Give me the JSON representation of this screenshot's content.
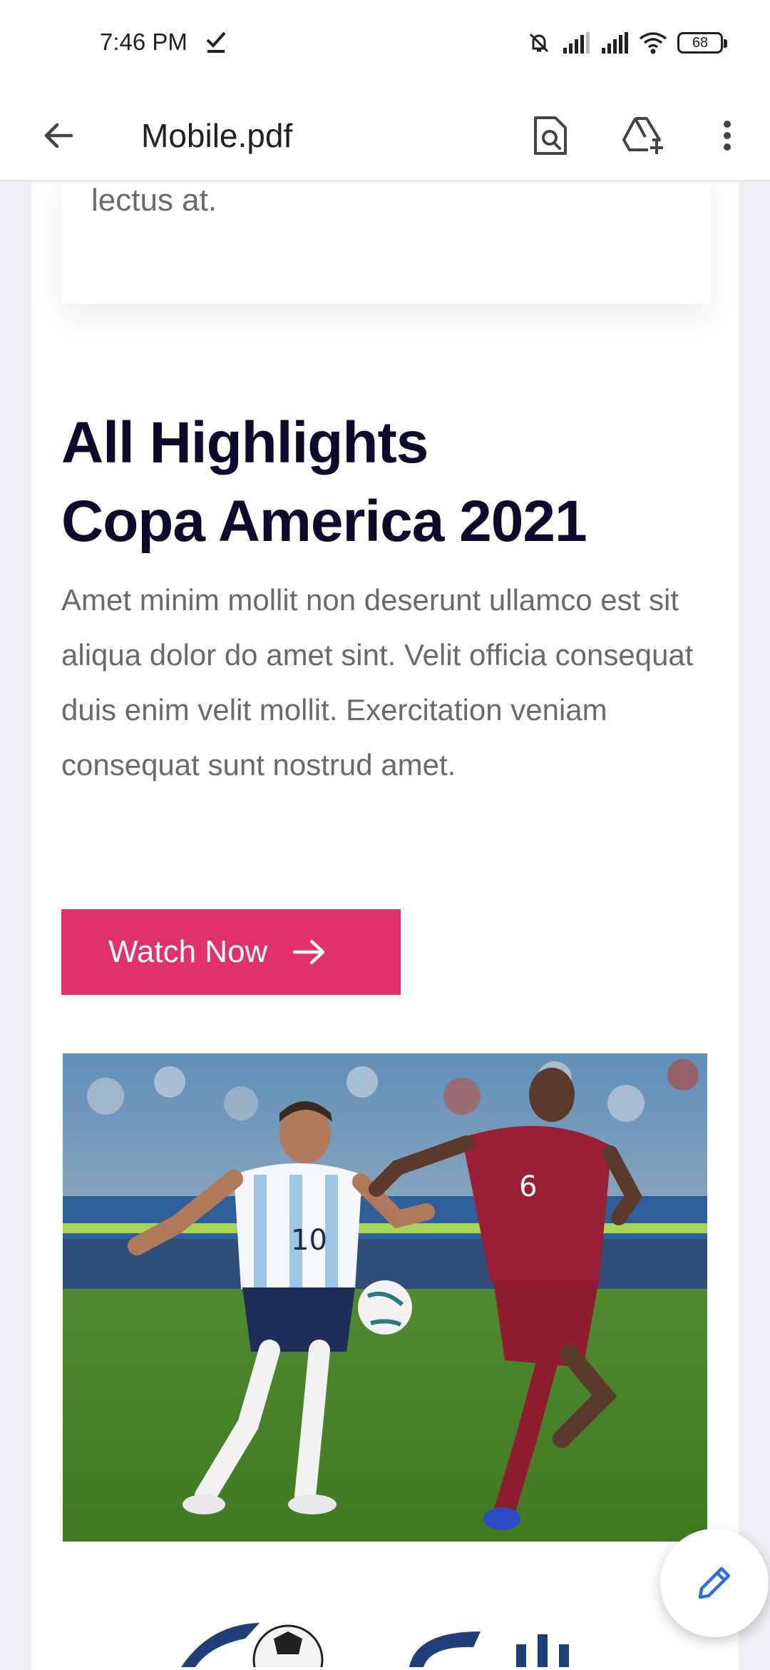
{
  "status_bar": {
    "time": "7:46 PM",
    "battery": "68",
    "icons": [
      "check-icon",
      "mute-icon",
      "signal-icon",
      "signal-icon",
      "wifi-icon",
      "battery-icon"
    ]
  },
  "app_bar": {
    "title": "Mobile.pdf",
    "actions": [
      "back-arrow-icon",
      "search-document-icon",
      "add-to-drive-icon",
      "more-vert-icon"
    ]
  },
  "document": {
    "card_text": "lectus at.",
    "headline_line1": "All Highlights",
    "headline_line2": "Copa America 2021",
    "body": "Amet minim mollit non deserunt ullamco est sit aliqua dolor do amet sint. Velit officia consequat duis enim velit mollit. Exercitation veniam consequat sunt nostrud amet.",
    "button_label": "Watch Now",
    "colors": {
      "button": "#e0316c",
      "headline": "#0d0b2b",
      "body": "#6a6a6a"
    }
  },
  "fab": {
    "icon": "edit-pencil-icon"
  }
}
